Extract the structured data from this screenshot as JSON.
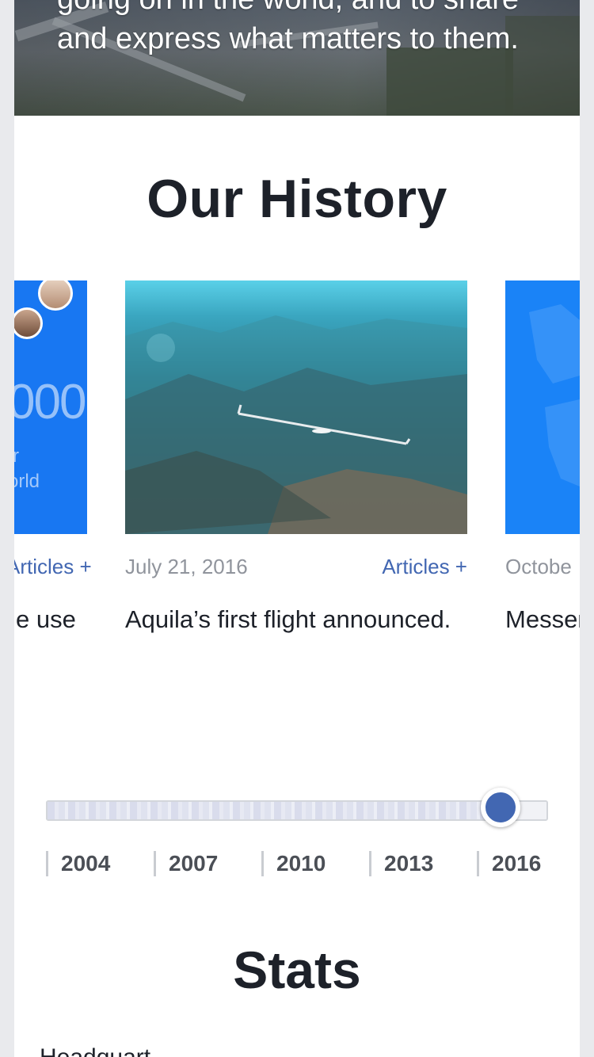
{
  "hero": {
    "text_line1": "going on in the world, and to share",
    "text_line2": "and express what matters to them."
  },
  "history": {
    "title": "Our History",
    "cards": [
      {
        "date": "",
        "tag": "Articles +",
        "description": "e use",
        "image_text_large": "000",
        "image_text_small1": "r",
        "image_text_small2": "orld"
      },
      {
        "date": "July 21, 2016",
        "tag": "Articles +",
        "description": "Aquila’s first flight announced."
      },
      {
        "date": "Octobe",
        "tag": "",
        "description": "Messer"
      }
    ]
  },
  "timeline": {
    "years": [
      "2004",
      "2007",
      "2010",
      "2013",
      "2016"
    ],
    "selected_year": "2016",
    "position_fraction": 0.905
  },
  "stats": {
    "title": "Stats",
    "first_item_partial": "Headquart"
  },
  "colors": {
    "accent": "#4267b2",
    "facebook_blue": "#1877f2",
    "text": "#1d2129",
    "muted": "#90949c"
  }
}
